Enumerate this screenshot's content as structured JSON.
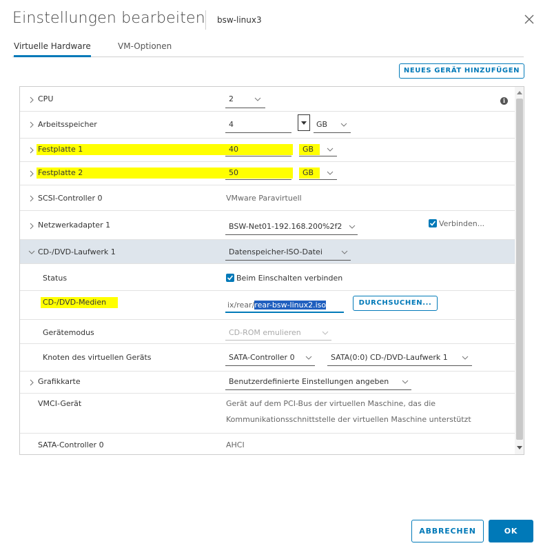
{
  "dialog": {
    "title": "Einstellungen bearbeiten",
    "vm_name": "bsw-linux3"
  },
  "tabs": [
    {
      "label": "Virtuelle Hardware",
      "active": true
    },
    {
      "label": "VM-Optionen",
      "active": false
    }
  ],
  "toolbar": {
    "add_device_label": "NEUES GERÄT HINZUFÜGEN"
  },
  "rows": {
    "cpu": {
      "label": "CPU",
      "value": "2"
    },
    "memory": {
      "label": "Arbeitsspeicher",
      "value": "4",
      "unit": "GB"
    },
    "disk1": {
      "label": "Festplatte 1",
      "value": "40",
      "unit": "GB"
    },
    "disk2": {
      "label": "Festplatte 2",
      "value": "50",
      "unit": "GB"
    },
    "scsi": {
      "label": "SCSI-Controller 0",
      "value": "VMware Paravirtuell"
    },
    "network": {
      "label": "Netzwerkadapter 1",
      "value": "BSW-Net01-192.168.200%2f2",
      "connect_label": "Verbinden...",
      "connect_checked": true
    },
    "cddvd": {
      "label": "CD-/DVD-Laufwerk 1",
      "value": "Datenspeicher-ISO-Datei"
    },
    "status": {
      "label": "Status",
      "value": "Beim Einschalten verbinden",
      "checked": true
    },
    "media": {
      "label": "CD-/DVD-Medien",
      "path_prefix": "ix/rear/",
      "path_selected": "rear-bsw-linux2.iso",
      "browse_label": "DURCHSUCHEN..."
    },
    "device_mode": {
      "label": "Gerätemodus",
      "value": "CD-ROM emulieren"
    },
    "node": {
      "label": "Knoten des virtuellen Geräts",
      "controller": "SATA-Controller 0",
      "slot": "SATA(0:0) CD-/DVD-Laufwerk 1"
    },
    "graphics": {
      "label": "Grafikkarte",
      "value": "Benutzerdefinierte Einstellungen angeben"
    },
    "vmci": {
      "label": "VMCI-Gerät",
      "line1": "Gerät auf dem PCI-Bus der virtuellen Maschine, das die",
      "line2": "Kommunikationsschnittstelle der virtuellen Maschine unterstützt"
    },
    "sata": {
      "label": "SATA-Controller 0",
      "value": "AHCI"
    }
  },
  "footer": {
    "cancel_label": "ABBRECHEN",
    "ok_label": "OK"
  },
  "colors": {
    "accent": "#0079b8",
    "highlight": "#ffff00",
    "expanded_row_bg": "#dee5ec"
  }
}
